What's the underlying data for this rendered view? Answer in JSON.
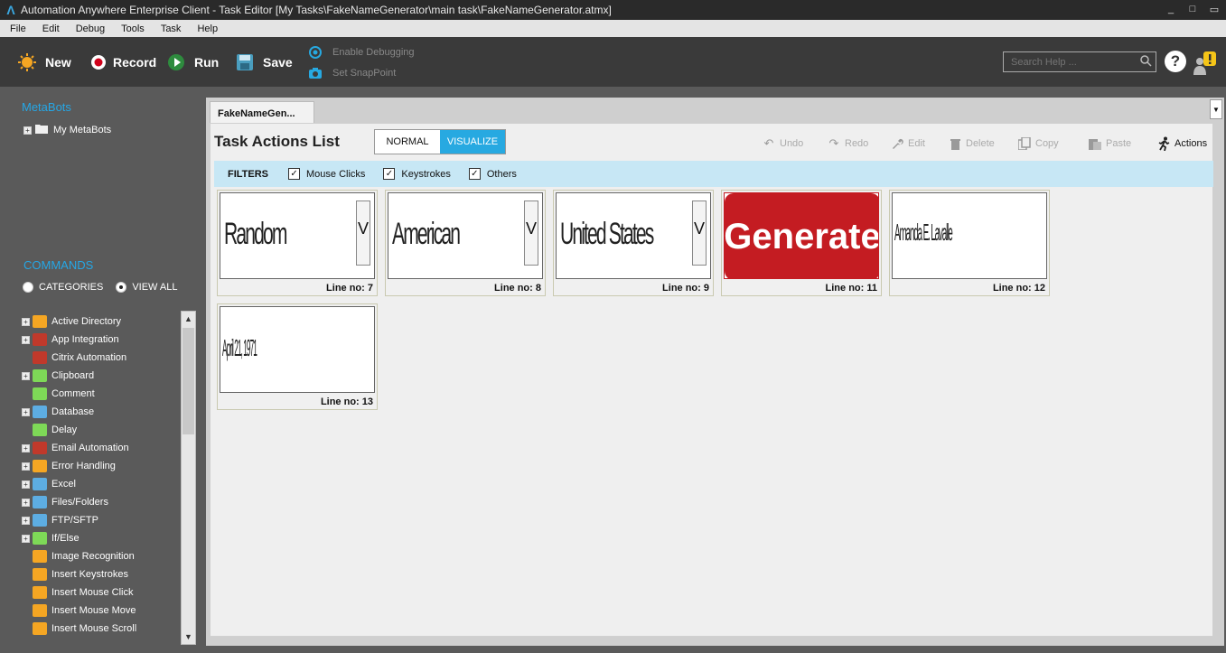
{
  "window": {
    "title": "Automation Anywhere Enterprise Client - Task Editor [My Tasks\\FakeNameGenerator\\main task\\FakeNameGenerator.atmx]",
    "controls": [
      "_",
      "□",
      "▭"
    ]
  },
  "menu": [
    "File",
    "Edit",
    "Debug",
    "Tools",
    "Task",
    "Help"
  ],
  "toolbar": {
    "new": "New",
    "record": "Record",
    "run": "Run",
    "save": "Save",
    "enable_debugging": "Enable Debugging",
    "set_snappoint": "Set SnapPoint",
    "search_placeholder": "Search Help ..."
  },
  "left": {
    "metabots_title": "MetaBots",
    "my_metabots": "My MetaBots",
    "commands_title": "COMMANDS",
    "categories": "CATEGORIES",
    "view_all": "VIEW ALL",
    "commands": [
      {
        "label": "Active Directory",
        "expand": true,
        "color": "#f5a623"
      },
      {
        "label": "App Integration",
        "expand": true,
        "color": "#c0392b"
      },
      {
        "label": "Citrix Automation",
        "expand": false,
        "color": "#c0392b"
      },
      {
        "label": "Clipboard",
        "expand": true,
        "color": "#7ed957"
      },
      {
        "label": "Comment",
        "expand": false,
        "color": "#7ed957"
      },
      {
        "label": "Database",
        "expand": true,
        "color": "#5dade2"
      },
      {
        "label": "Delay",
        "expand": false,
        "color": "#7ed957"
      },
      {
        "label": "Email Automation",
        "expand": true,
        "color": "#c0392b"
      },
      {
        "label": "Error Handling",
        "expand": true,
        "color": "#f5a623"
      },
      {
        "label": "Excel",
        "expand": true,
        "color": "#5dade2"
      },
      {
        "label": "Files/Folders",
        "expand": true,
        "color": "#5dade2"
      },
      {
        "label": "FTP/SFTP",
        "expand": true,
        "color": "#5dade2"
      },
      {
        "label": "If/Else",
        "expand": true,
        "color": "#7ed957"
      },
      {
        "label": "Image Recognition",
        "expand": false,
        "color": "#f5a623"
      },
      {
        "label": "Insert Keystrokes",
        "expand": false,
        "color": "#f5a623"
      },
      {
        "label": "Insert Mouse Click",
        "expand": false,
        "color": "#f5a623"
      },
      {
        "label": "Insert Mouse Move",
        "expand": false,
        "color": "#f5a623"
      },
      {
        "label": "Insert Mouse Scroll",
        "expand": false,
        "color": "#f5a623"
      }
    ]
  },
  "main": {
    "tab": "FakeNameGen...",
    "heading": "Task Actions List",
    "normal": "NORMAL",
    "visualize": "VISUALIZE",
    "actions": {
      "undo": "Undo",
      "redo": "Redo",
      "edit": "Edit",
      "delete": "Delete",
      "copy": "Copy",
      "paste": "Paste",
      "actions": "Actions"
    },
    "filters": {
      "label": "FILTERS",
      "mouse_clicks": "Mouse Clicks",
      "keystrokes": "Keystrokes",
      "others": "Others"
    },
    "cards": [
      {
        "text": "Random",
        "line": "Line no: 7"
      },
      {
        "text": "American",
        "line": "Line no: 8"
      },
      {
        "text": "United States",
        "line": "Line no: 9"
      },
      {
        "text": "Generate",
        "line": "Line no: 11"
      },
      {
        "text": "Amanda E. Lavalle",
        "line": "Line no: 12"
      },
      {
        "text": "April 21, 1971",
        "line": "Line no: 13"
      }
    ]
  }
}
